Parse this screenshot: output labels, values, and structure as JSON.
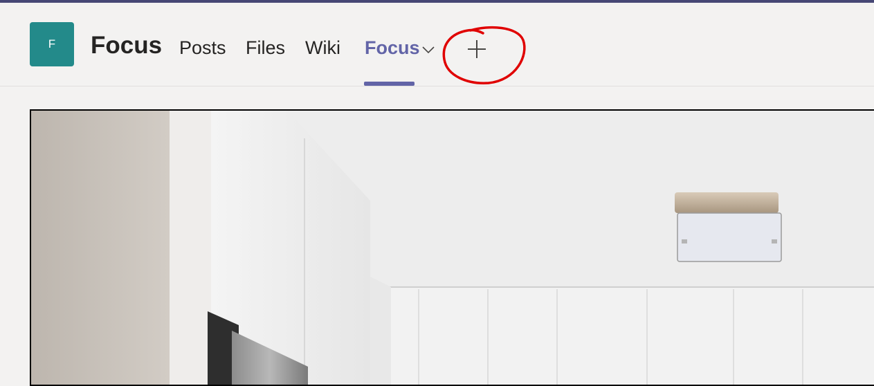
{
  "team": {
    "initial": "F",
    "name": "Focus",
    "avatar_color": "#238a8a"
  },
  "tabs": [
    {
      "label": "Posts",
      "active": false
    },
    {
      "label": "Files",
      "active": false
    },
    {
      "label": "Wiki",
      "active": false
    },
    {
      "label": "Focus",
      "active": true
    }
  ],
  "active_tab_dropdown_icon": "chevron-down-icon",
  "add_tab_icon": "plus-icon",
  "colors": {
    "topbar": "#464775",
    "accent": "#6264a7",
    "annotation": "#e00000"
  },
  "content": {
    "image_subject": "kitchen-interior-photo"
  }
}
